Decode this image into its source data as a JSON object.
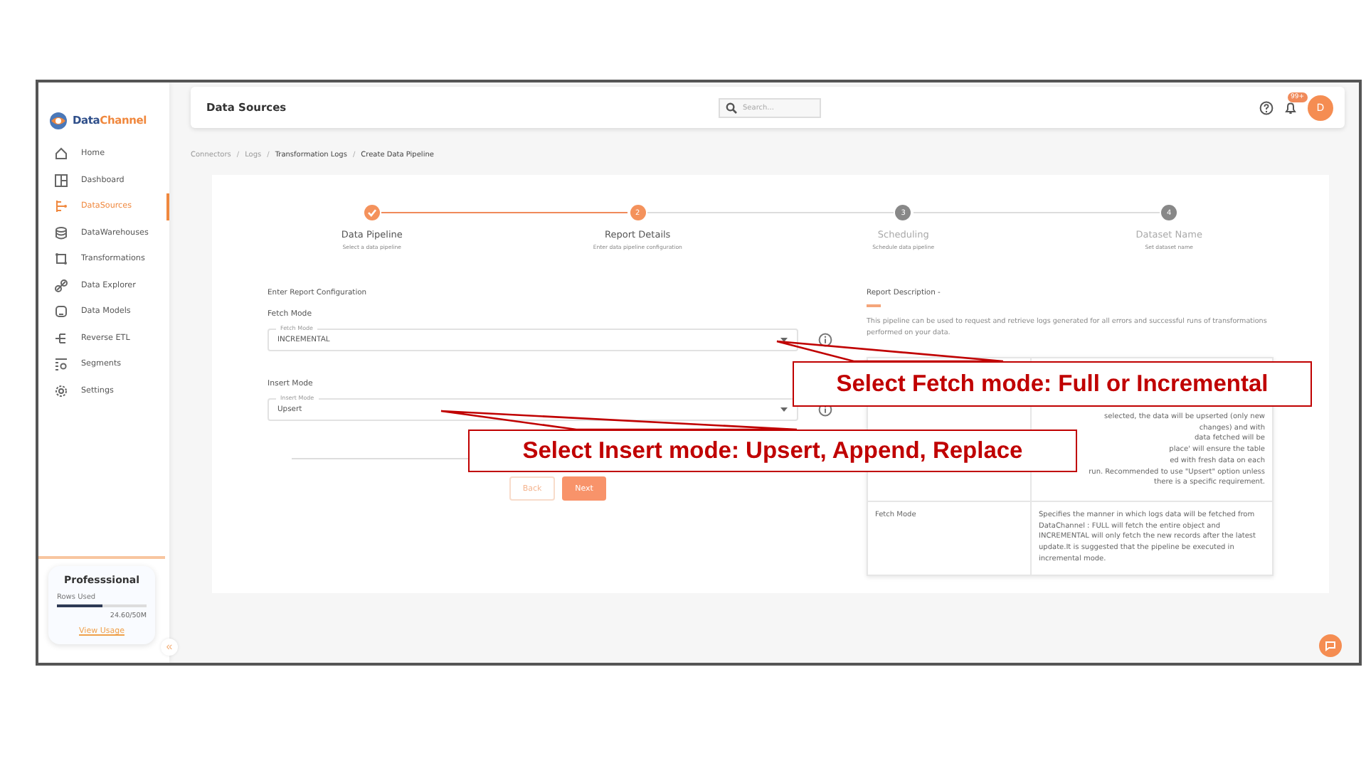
{
  "sidebar": {
    "logo": {
      "text": "Data",
      "accent": "Channel"
    },
    "items": [
      {
        "label": "Home",
        "selected": false
      },
      {
        "label": "Dashboard",
        "selected": false
      },
      {
        "label": "DataSources",
        "selected": true
      },
      {
        "label": "DataWarehouses",
        "selected": false
      },
      {
        "label": "Transformations",
        "selected": false
      },
      {
        "label": "Data Explorer",
        "selected": false
      },
      {
        "label": "Data Models",
        "selected": false
      },
      {
        "label": "Reverse ETL",
        "selected": false
      },
      {
        "label": "Segments",
        "selected": false
      },
      {
        "label": "Settings",
        "selected": false
      }
    ],
    "plan": {
      "name": "Professsional",
      "usage_label": "Rows Used",
      "level": 0.5,
      "usage": "24.60/50M",
      "link": "View Usage"
    },
    "collapse": "«"
  },
  "topbar": {
    "title": "Data Sources",
    "search": {
      "placeholder": "Search..."
    },
    "badge": "99+",
    "avatar": "D"
  },
  "breadcrumb": {
    "separator": "/",
    "items": [
      {
        "label": "Connectors",
        "muted": true
      },
      {
        "label": "Logs",
        "muted": true
      },
      {
        "label": "Transformation Logs",
        "muted": false
      },
      {
        "label": "Create Data Pipeline",
        "muted": false
      }
    ]
  },
  "steps": [
    {
      "kind": "done",
      "title": "Data Pipeline",
      "subtitle": "Select a data pipeline"
    },
    {
      "kind": "current",
      "number": "2",
      "title": "Report Details",
      "subtitle": "Enter data pipeline configuration"
    },
    {
      "kind": "pending",
      "number": "3",
      "title": "Scheduling",
      "subtitle": "Schedule data pipeline"
    },
    {
      "kind": "pending",
      "number": "4",
      "title": "Dataset Name",
      "subtitle": "Set dataset name"
    }
  ],
  "form": {
    "heading": "Enter Report Configuration",
    "fields": [
      {
        "label": "Fetch Mode",
        "floating_label": "Fetch Mode",
        "value": "INCREMENTAL"
      },
      {
        "label": "Insert Mode",
        "floating_label": "Insert Mode",
        "value": "Upsert"
      }
    ],
    "buttons": [
      {
        "label": "Back",
        "kind": "secondary"
      },
      {
        "label": "Next",
        "kind": "primary"
      }
    ]
  },
  "description": {
    "heading": "Report Description -",
    "text": "This pipeline can be used to request and retrieve logs generated for all errors and successful runs of transformations performed on your data.",
    "rows": [
      {
        "lines": [
          "selected, the data will be upserted (only new",
          "changes) and with",
          "data fetched will be",
          "place' will ensure the table",
          "ed with fresh data on each",
          "run. Recommended to use \"Upsert\" option unless",
          "there is a specific requirement."
        ]
      },
      {
        "name": "Fetch Mode",
        "lines": [
          "Specifies the manner in which logs data will be fetched from DataChannel : FULL will fetch the entire object and INCREMENTAL will only fetch the new records after the latest update.It is suggested that the pipeline be executed in incremental mode."
        ]
      }
    ]
  },
  "callouts": [
    {
      "text": "Select Fetch mode: Full or Incremental"
    },
    {
      "text": "Select Insert mode: Upsert, Append, Replace"
    }
  ]
}
